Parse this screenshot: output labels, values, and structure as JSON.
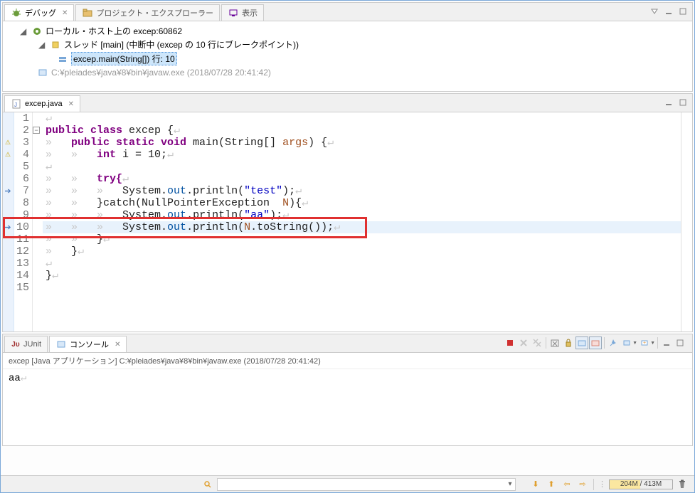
{
  "debugPanel": {
    "tabs": {
      "debug": "デバッグ",
      "explorer": "プロジェクト・エクスプローラー",
      "display": "表示"
    },
    "tree": {
      "root": "ローカル・ホスト上の excep:60862",
      "thread": "スレッド [main] (中断中 (excep の 10 行にブレークポイント))",
      "frame": "excep.main(String[]) 行: 10",
      "process": "C:¥pleiades¥java¥8¥bin¥javaw.exe (2018/07/28 20:41:42)"
    }
  },
  "editor": {
    "tabName": "excep.java",
    "code": {
      "l1": "↵",
      "l2_kw": "public class",
      "l2_name": " excep {",
      "l3_kw": "public static void",
      "l3_name": " main(String[] ",
      "l3_param": "args",
      "l3_end": ") {",
      "l4_kw": "int",
      "l4_rest": " i = 10;",
      "l5": "",
      "l6": "try{",
      "l7_pre": "System.",
      "l7_out": "out",
      "l7_mid": ".println(",
      "l7_str": "\"test\"",
      "l7_end": ");",
      "l8_pre": "}catch(NullPointerException  ",
      "l8_param": "N",
      "l8_end": "){",
      "l9_pre": "System.",
      "l9_out": "out",
      "l9_mid": ".println(",
      "l9_str": "\"aa\"",
      "l9_end": ");",
      "l10_pre": "System.",
      "l10_out": "out",
      "l10_mid": ".println(",
      "l10_param": "N",
      "l10_call": ".toString());",
      "l11": "}",
      "l12": "}",
      "l13": "",
      "l14": "}",
      "l15": ""
    },
    "lineNumbers": [
      "1",
      "2",
      "3",
      "4",
      "5",
      "6",
      "7",
      "8",
      "9",
      "10",
      "11",
      "12",
      "13",
      "14",
      "15"
    ]
  },
  "console": {
    "tabs": {
      "junit": "JUnit",
      "console": "コンソール"
    },
    "info": "excep [Java アプリケーション] C:¥pleiades¥java¥8¥bin¥javaw.exe (2018/07/28 20:41:42)",
    "output": "aa"
  },
  "status": {
    "memory": "204M / 413M"
  }
}
